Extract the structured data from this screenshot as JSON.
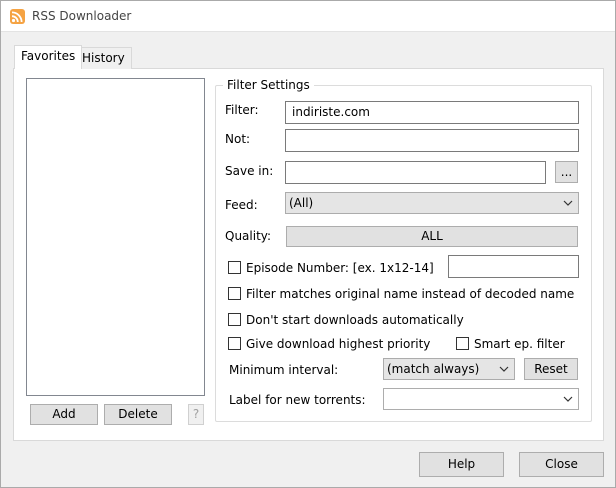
{
  "window": {
    "title": "RSS Downloader",
    "icon": "rss-icon"
  },
  "tabs": [
    {
      "label": "Favorites",
      "active": true
    },
    {
      "label": "History",
      "active": false
    }
  ],
  "favorites": {
    "items": [],
    "add_label": "Add",
    "delete_label": "Delete",
    "help_label": "?"
  },
  "filter_settings": {
    "title": "Filter Settings",
    "filter_label": "Filter:",
    "filter_value": "indiriste.com",
    "not_label": "Not:",
    "not_value": "",
    "save_in_label": "Save in:",
    "save_in_value": "",
    "browse_label": "...",
    "feed_label": "Feed:",
    "feed_value": "(All)",
    "quality_label": "Quality:",
    "quality_value": "ALL",
    "episode_label": "Episode Number: [ex. 1x12-14]",
    "episode_checked": false,
    "episode_value": "",
    "original_name_label": "Filter matches original name instead of decoded name",
    "original_name_checked": false,
    "no_auto_start_label": "Don't start downloads automatically",
    "no_auto_start_checked": false,
    "high_priority_label": "Give download highest priority",
    "high_priority_checked": false,
    "smart_filter_label": "Smart ep. filter",
    "smart_filter_checked": false,
    "min_interval_label": "Minimum interval:",
    "min_interval_value": "(match always)",
    "reset_label": "Reset",
    "label_for_torrents_label": "Label for new torrents:",
    "label_for_torrents_value": ""
  },
  "footer": {
    "help_label": "Help",
    "close_label": "Close"
  }
}
